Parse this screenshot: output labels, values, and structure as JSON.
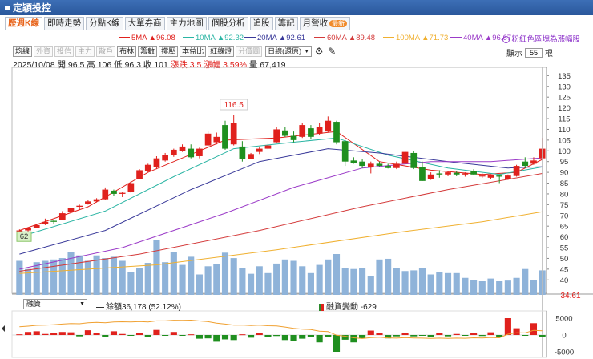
{
  "window": {
    "title": "定穎投控"
  },
  "tabs": [
    {
      "label": "歷週K線",
      "active": true
    },
    {
      "label": "即時走勢"
    },
    {
      "label": "分點K線"
    },
    {
      "label": "大單券商"
    },
    {
      "label": "主力地圖"
    },
    {
      "label": "個股分析"
    },
    {
      "label": "追股"
    },
    {
      "label": "籌記"
    },
    {
      "label": "月營收",
      "badge": "最新"
    }
  ],
  "ma_legend": [
    {
      "label": "5MA",
      "value": "96.08",
      "color": "#e0211d"
    },
    {
      "label": "10MA",
      "value": "92.32",
      "color": "#2bb5a4"
    },
    {
      "label": "20MA",
      "value": "92.61",
      "color": "#3a3a9a"
    },
    {
      "label": "60MA",
      "value": "89.48",
      "color": "#d43b3b"
    },
    {
      "label": "100MA",
      "value": "71.73",
      "color": "#f0b030"
    },
    {
      "label": "40MA",
      "value": "96.67",
      "color": "#9b3bc8"
    }
  ],
  "ma_arrow": "▲",
  "red_bear_note": "粉紅色區塊為漲幅股",
  "toolbar": {
    "buttons": [
      {
        "label": "均線"
      },
      {
        "label": "外資",
        "disabled": true
      },
      {
        "label": "投信",
        "disabled": true
      },
      {
        "label": "主力",
        "disabled": true
      },
      {
        "label": "散戶",
        "disabled": true
      },
      {
        "label": "布林"
      },
      {
        "label": "籌數"
      },
      {
        "label": "撐壓"
      },
      {
        "label": "本益比"
      },
      {
        "label": "紅綠燈"
      },
      {
        "label": "分價圖",
        "disabled": true
      }
    ],
    "period": "日線(還原)",
    "display_label": "顯示",
    "display_value": "55",
    "display_unit": "根"
  },
  "ohlc": {
    "date": "2025/10/08",
    "open_label": "開",
    "open": "96.5",
    "high_label": "高",
    "high": "106",
    "low_label": "低",
    "low": "96.3",
    "close_label": "收",
    "close": "101",
    "change_label": "漲跌",
    "change": "3.5",
    "pct_label": "漲幅",
    "pct": "3.59%",
    "vol_label": "量",
    "vol": "67,419"
  },
  "annotations": {
    "high_marker": "116.5",
    "low_marker": "62"
  },
  "chart_data": {
    "type": "candlestick",
    "yaxis_ticks": [
      "135",
      "130",
      "125",
      "120",
      "115",
      "110",
      "105",
      "100",
      "95",
      "90",
      "85",
      "80",
      "75",
      "70",
      "65",
      "60",
      "55",
      "50",
      "45",
      "40"
    ],
    "ylim": [
      36,
      137
    ],
    "candles": [
      {
        "o": 62.5,
        "h": 63.5,
        "l": 61.5,
        "c": 63
      },
      {
        "o": 63,
        "h": 64.5,
        "l": 62.5,
        "c": 64
      },
      {
        "o": 64.3,
        "h": 66,
        "l": 64,
        "c": 65.5
      },
      {
        "o": 66,
        "h": 68.5,
        "l": 65.5,
        "c": 67
      },
      {
        "o": 67.5,
        "h": 68,
        "l": 66,
        "c": 67
      },
      {
        "o": 68,
        "h": 72,
        "l": 67.8,
        "c": 71
      },
      {
        "o": 71.5,
        "h": 74,
        "l": 71,
        "c": 73.5
      },
      {
        "o": 74,
        "h": 75,
        "l": 72.5,
        "c": 74.5
      },
      {
        "o": 75.5,
        "h": 77,
        "l": 75,
        "c": 76.5
      },
      {
        "o": 76.5,
        "h": 78,
        "l": 76,
        "c": 77.5
      },
      {
        "o": 77.5,
        "h": 83,
        "l": 77,
        "c": 82
      },
      {
        "o": 81.5,
        "h": 82,
        "l": 79,
        "c": 80
      },
      {
        "o": 80,
        "h": 81,
        "l": 78.5,
        "c": 80.5
      },
      {
        "o": 81,
        "h": 86,
        "l": 80.5,
        "c": 85
      },
      {
        "o": 87,
        "h": 91.5,
        "l": 86.8,
        "c": 91
      },
      {
        "o": 90.5,
        "h": 94,
        "l": 90,
        "c": 93.5
      },
      {
        "o": 92.5,
        "h": 97.5,
        "l": 91.5,
        "c": 96.5
      },
      {
        "o": 95.5,
        "h": 99,
        "l": 95,
        "c": 98
      },
      {
        "o": 98,
        "h": 101,
        "l": 97.2,
        "c": 100.5
      },
      {
        "o": 100,
        "h": 103,
        "l": 99.5,
        "c": 102
      },
      {
        "o": 101,
        "h": 103,
        "l": 96.5,
        "c": 97
      },
      {
        "o": 97.5,
        "h": 101.5,
        "l": 96.5,
        "c": 101
      },
      {
        "o": 102.5,
        "h": 109,
        "l": 101.5,
        "c": 108
      },
      {
        "o": 104,
        "h": 108.5,
        "l": 103,
        "c": 106.5
      },
      {
        "o": 112,
        "h": 114,
        "l": 100.5,
        "c": 101
      },
      {
        "o": 103,
        "h": 116.5,
        "l": 102.5,
        "c": 113
      },
      {
        "o": 102,
        "h": 104.5,
        "l": 95,
        "c": 96
      },
      {
        "o": 96.2,
        "h": 99,
        "l": 96,
        "c": 98.5
      },
      {
        "o": 99.5,
        "h": 102,
        "l": 98.5,
        "c": 101
      },
      {
        "o": 101,
        "h": 104,
        "l": 100.5,
        "c": 102.5
      },
      {
        "o": 104,
        "h": 111,
        "l": 103.5,
        "c": 110
      },
      {
        "o": 109.5,
        "h": 111,
        "l": 106.5,
        "c": 107
      },
      {
        "o": 107,
        "h": 109,
        "l": 104,
        "c": 105
      },
      {
        "o": 106.5,
        "h": 113,
        "l": 106,
        "c": 112
      },
      {
        "o": 110.5,
        "h": 112,
        "l": 105.5,
        "c": 106.5
      },
      {
        "o": 108,
        "h": 113,
        "l": 107.5,
        "c": 111
      },
      {
        "o": 109,
        "h": 116,
        "l": 108.5,
        "c": 114
      },
      {
        "o": 113.5,
        "h": 114,
        "l": 103,
        "c": 104
      },
      {
        "o": 104.5,
        "h": 105,
        "l": 93,
        "c": 95
      },
      {
        "o": 95.5,
        "h": 97,
        "l": 94,
        "c": 94.5
      },
      {
        "o": 95,
        "h": 96,
        "l": 92,
        "c": 93
      },
      {
        "o": 92.5,
        "h": 95,
        "l": 89.5,
        "c": 94
      },
      {
        "o": 94,
        "h": 95,
        "l": 92.8,
        "c": 93
      },
      {
        "o": 93,
        "h": 94,
        "l": 91.8,
        "c": 92
      },
      {
        "o": 92,
        "h": 95,
        "l": 91.5,
        "c": 94
      },
      {
        "o": 94,
        "h": 100,
        "l": 93.8,
        "c": 99.5
      },
      {
        "o": 99,
        "h": 100,
        "l": 91.5,
        "c": 92
      },
      {
        "o": 92.5,
        "h": 95,
        "l": 86,
        "c": 86
      },
      {
        "o": 87,
        "h": 90,
        "l": 86.5,
        "c": 89
      },
      {
        "o": 89.5,
        "h": 91,
        "l": 87.5,
        "c": 89
      },
      {
        "o": 89,
        "h": 90.5,
        "l": 88.2,
        "c": 90
      },
      {
        "o": 89.8,
        "h": 90.5,
        "l": 88.2,
        "c": 89
      },
      {
        "o": 89,
        "h": 90,
        "l": 88,
        "c": 89.5
      },
      {
        "o": 90.5,
        "h": 91.5,
        "l": 88.8,
        "c": 89
      },
      {
        "o": 88.5,
        "h": 89.5,
        "l": 87.5,
        "c": 88.5
      },
      {
        "o": 87.5,
        "h": 89,
        "l": 87,
        "c": 88.7
      },
      {
        "o": 88.5,
        "h": 89,
        "l": 85,
        "c": 88
      },
      {
        "o": 87,
        "h": 89,
        "l": 86.5,
        "c": 88.5
      },
      {
        "o": 88.3,
        "h": 93.5,
        "l": 88,
        "c": 93
      },
      {
        "o": 95,
        "h": 97,
        "l": 92,
        "c": 93
      },
      {
        "o": 94,
        "h": 97,
        "l": 93.5,
        "c": 95.5
      },
      {
        "o": 96.5,
        "h": 106,
        "l": 96.3,
        "c": 101
      }
    ],
    "ma_lines": {
      "5MA": [
        [
          0,
          63
        ],
        [
          8,
          74
        ],
        [
          15,
          90
        ],
        [
          24,
          105
        ],
        [
          30,
          106
        ],
        [
          37,
          109
        ],
        [
          42,
          95
        ],
        [
          48,
          91
        ],
        [
          54,
          89
        ],
        [
          58,
          90
        ],
        [
          61,
          96
        ]
      ],
      "10MA": [
        [
          0,
          60
        ],
        [
          10,
          72
        ],
        [
          18,
          88
        ],
        [
          25,
          101
        ],
        [
          32,
          104
        ],
        [
          37,
          106
        ],
        [
          43,
          98
        ],
        [
          50,
          92
        ],
        [
          56,
          89
        ],
        [
          61,
          92.5
        ]
      ],
      "20MA": [
        [
          0,
          52
        ],
        [
          10,
          63
        ],
        [
          20,
          82
        ],
        [
          28,
          95
        ],
        [
          36,
          101
        ],
        [
          42,
          99
        ],
        [
          50,
          95
        ],
        [
          57,
          92
        ],
        [
          61,
          92.6
        ]
      ],
      "40MA": [
        [
          0,
          45
        ],
        [
          12,
          55
        ],
        [
          24,
          71
        ],
        [
          32,
          83
        ],
        [
          40,
          92
        ],
        [
          48,
          95
        ],
        [
          55,
          95
        ],
        [
          61,
          96.7
        ]
      ],
      "60MA": [
        [
          0,
          44
        ],
        [
          14,
          52
        ],
        [
          28,
          63
        ],
        [
          40,
          74
        ],
        [
          50,
          82
        ],
        [
          61,
          89.5
        ]
      ],
      "100MA": [
        [
          0,
          43
        ],
        [
          16,
          47
        ],
        [
          30,
          54
        ],
        [
          44,
          62
        ],
        [
          54,
          67
        ],
        [
          61,
          71.7
        ]
      ]
    },
    "volume": {
      "values": [
        50,
        38,
        48,
        50,
        52,
        54,
        63,
        58,
        50,
        58,
        54,
        56,
        50,
        34,
        40,
        47,
        80,
        48,
        63,
        44,
        56,
        30,
        42,
        45,
        62,
        54,
        40,
        31,
        42,
        32,
        46,
        52,
        50,
        42,
        32,
        44,
        52,
        60,
        40,
        38,
        40,
        28,
        52,
        53,
        40,
        35,
        36,
        40,
        30,
        34,
        32,
        32,
        25,
        22,
        20,
        24,
        20,
        21,
        25,
        38,
        22,
        36
      ],
      "red": [
        false,
        false,
        true,
        false,
        true,
        true,
        false,
        false,
        true,
        false,
        true,
        false,
        true,
        false,
        true,
        true,
        true,
        false,
        true,
        false,
        true,
        false,
        true,
        true,
        true,
        true,
        false,
        true,
        true,
        true,
        true,
        false,
        false,
        true,
        false,
        true,
        true,
        false,
        false,
        false,
        false,
        true,
        false,
        true,
        false,
        true,
        false,
        false,
        true,
        false,
        false,
        true,
        false,
        false,
        false,
        true,
        false,
        true,
        true,
        false,
        true,
        true
      ],
      "axis_label": "34.61"
    }
  },
  "sub_chart": {
    "selector": "融資",
    "legend_line": "餘額36,178 (52.12%)",
    "legend_bar": "融資變動 -629",
    "yaxis_ticks": [
      "5000",
      "0",
      "-5000"
    ],
    "changes": [
      200,
      900,
      1100,
      300,
      600,
      900,
      800,
      -400,
      1400,
      600,
      -600,
      1100,
      300,
      -200,
      600,
      -600,
      1500,
      -100,
      900,
      -100,
      200,
      -1100,
      -1000,
      -2000,
      -1300,
      -1500,
      200,
      -800,
      500,
      -700,
      -300,
      -1500,
      -1800,
      -1100,
      -700,
      -2200,
      -500,
      -5000,
      -1400,
      -2200,
      -1000,
      1300,
      600,
      -1000,
      -400,
      700,
      -400,
      -200,
      -500,
      500,
      -400,
      300,
      -200,
      700,
      -300,
      800,
      -500,
      5000,
      2000,
      -200,
      3500,
      -629
    ]
  }
}
